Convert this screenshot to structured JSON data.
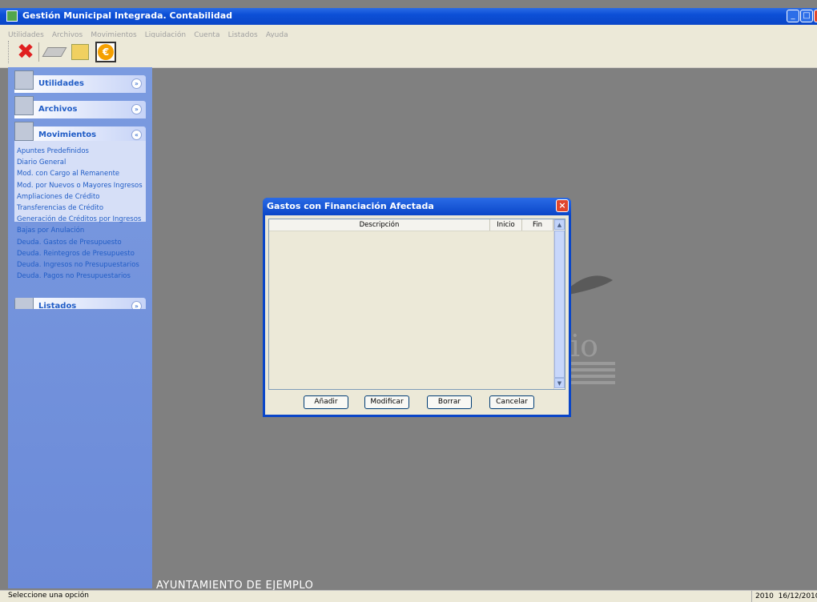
{
  "app": {
    "title": "Gestión Municipal Integrada. Contabilidad",
    "window_buttons": [
      "minimize-icon",
      "maximize-icon",
      "close-icon"
    ]
  },
  "menu": [
    "Utilidades",
    "Archivos",
    "Movimientos",
    "Liquidación",
    "Cuenta",
    "Listados",
    "Ayuda"
  ],
  "toolbar": {
    "icons": [
      "close-x-icon",
      "eraser-icon",
      "edit-pencil-icon",
      "euro-coin-icon"
    ]
  },
  "sidebar": {
    "groups": [
      {
        "label": "Utilidades",
        "expanded": false
      },
      {
        "label": "Archivos",
        "expanded": false
      },
      {
        "label": "Movimientos",
        "expanded": true
      },
      {
        "label": "Listados",
        "expanded": false
      }
    ],
    "movimientos_items": [
      "Apuntes Predefinidos",
      "Diario General",
      "Mod. con Cargo al Remanente",
      "Mod. por Nuevos o Mayores Ingresos",
      "Ampliaciones de Crédito",
      "Transferencias de Crédito",
      "Generación de Créditos por Ingresos",
      "Bajas por Anulación",
      "Deuda. Gastos de Presupuesto",
      "Deuda. Reintegros de Presupuesto",
      "Deuda. Ingresos no Presupuestarios",
      "Deuda. Pagos no Presupuestarios"
    ],
    "collapse_glyph": "«",
    "expand_glyph": "»"
  },
  "dialog": {
    "title": "Gastos con Financiación Afectada",
    "columns": [
      "Descripción",
      "Inicio",
      "Fin"
    ],
    "rows": [],
    "buttons": [
      "Añadir",
      "Modificar",
      "Borrar",
      "Cancelar"
    ]
  },
  "footer": {
    "organization": "AYUNTAMIENTO DE EJEMPLO"
  },
  "status": {
    "message": "Seleccione una opción",
    "year": "2010",
    "date": "16/12/2010"
  },
  "colors": {
    "titlebar": "#0a46c8",
    "sidebar": "#7b9be0",
    "workspace": "#808080",
    "link": "#215dc6"
  }
}
